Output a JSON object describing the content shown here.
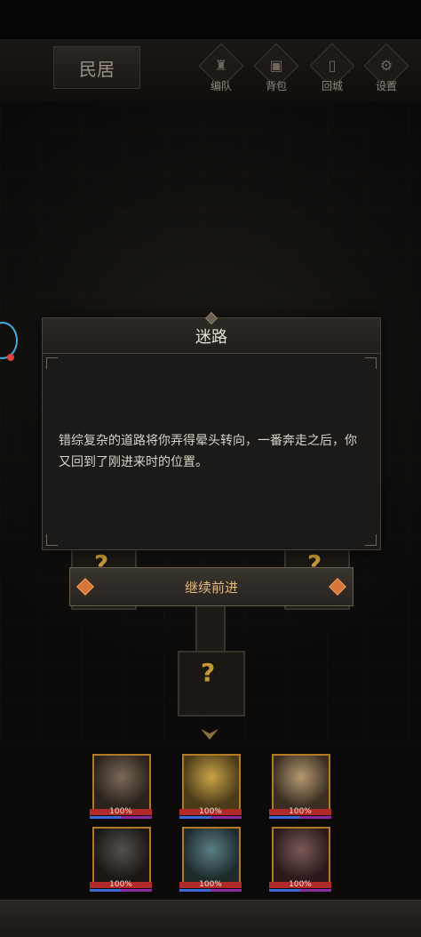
{
  "header": {
    "location": "民居",
    "menu": [
      {
        "label": "编队",
        "icon": "helmet-icon"
      },
      {
        "label": "背包",
        "icon": "bag-icon"
      },
      {
        "label": "回城",
        "icon": "door-icon"
      },
      {
        "label": "设置",
        "icon": "gear-icon"
      }
    ]
  },
  "dialog": {
    "title": "迷路",
    "body": "错综复杂的道路将你弄得晕头转向，一番奔走之后，你又回到了刚进来时的位置。"
  },
  "continue_button": "继续前进",
  "map": {
    "unknown_marker": "?"
  },
  "party": {
    "heroes": [
      {
        "hp": "100%",
        "hp_fraction": 1.0
      },
      {
        "hp": "100%",
        "hp_fraction": 1.0
      },
      {
        "hp": "100%",
        "hp_fraction": 1.0
      },
      {
        "hp": "100%",
        "hp_fraction": 1.0
      },
      {
        "hp": "100%",
        "hp_fraction": 1.0
      },
      {
        "hp": "100%",
        "hp_fraction": 1.0
      }
    ]
  },
  "colors": {
    "accent_gold": "#c69a33",
    "button_text": "#e0b880",
    "hp_red": "#b02a2a",
    "mp_blue": "#3a6ad8"
  }
}
